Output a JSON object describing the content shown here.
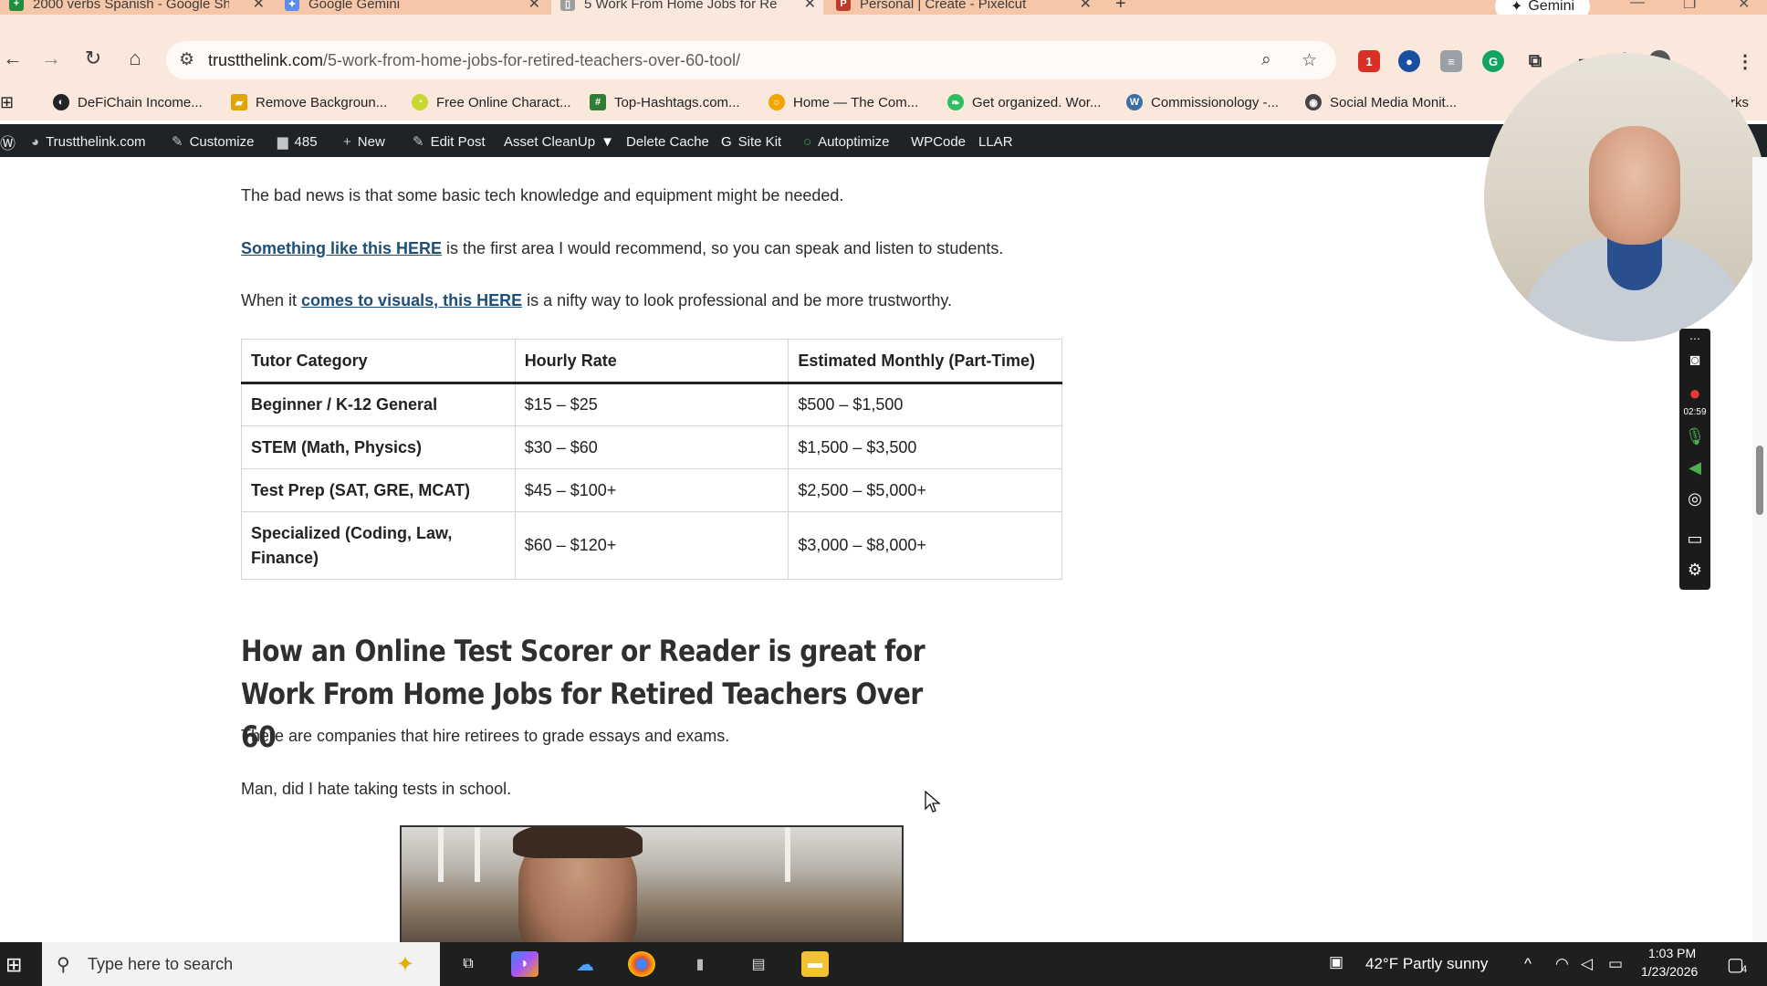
{
  "tabs": [
    {
      "title": "2000 verbs Spanish - Google Sh",
      "favicon": "sheets-icon",
      "color": "#1e8e3e",
      "glyph": "+"
    },
    {
      "title": "Google Gemini",
      "favicon": "gemini-icon",
      "color": "#5b8def",
      "glyph": "✦"
    },
    {
      "title": "5 Work From Home Jobs for Re",
      "favicon": "document-icon",
      "color": "#9e9e9e",
      "glyph": "▯",
      "active": true
    },
    {
      "title": "Personal | Create - Pixelcut",
      "favicon": "pixelcut-icon",
      "color": "#c0392b",
      "glyph": "P"
    }
  ],
  "new_tab": "+",
  "gemini_button": "Gemini",
  "address": {
    "host": "trustthelink.com",
    "path": "/5-work-from-home-jobs-for-retired-teachers-over-60-tool/"
  },
  "bookmarks": [
    {
      "label": "DeFiChain Income...",
      "icon": "defichain-icon",
      "color": "#222"
    },
    {
      "label": "Remove Backgroun...",
      "icon": "remove-bg-icon",
      "color": "#e1a400"
    },
    {
      "label": "Free Online Charact...",
      "icon": "character-icon",
      "color": "#c8d830"
    },
    {
      "label": "Top-Hashtags.com...",
      "icon": "hashtag-icon",
      "color": "#2e7d32"
    },
    {
      "label": "Home — The Com...",
      "icon": "sun-icon",
      "color": "#f0a500"
    },
    {
      "label": "Get organized. Wor...",
      "icon": "evernote-icon",
      "color": "#2dbe60"
    },
    {
      "label": "Commissionology -...",
      "icon": "wordpress-icon",
      "color": "#3b6ea5"
    },
    {
      "label": "Social Media Monit...",
      "icon": "eye-icon",
      "color": "#444"
    }
  ],
  "bookmarks_overflow": "rks",
  "wpbar": {
    "site": "Trustthelink.com",
    "customize": "Customize",
    "comments": "485",
    "new": "New",
    "edit_post": "Edit Post",
    "asset_cleanup": "Asset CleanUp",
    "delete_cache": "Delete Cache",
    "site_kit": "Site Kit",
    "autoptimize": "Autoptimize",
    "wpcode": "WPCode",
    "llar": "LLAR"
  },
  "content": {
    "p1": "The bad news is that some basic tech knowledge and equipment might be needed.",
    "p2_link": "Something like this HERE",
    "p2_rest": " is the first area I would recommend, so you can speak and listen to students.",
    "p3_start": "When it ",
    "p3_link": "comes to visuals, this HERE",
    "p3_rest": " is a nifty way to look professional and be more trustworthy.",
    "table": {
      "headers": [
        "Tutor Category",
        "Hourly Rate",
        "Estimated Monthly (Part-Time)"
      ],
      "rows": [
        [
          "Beginner / K-12 General",
          "$15 – $25",
          "$500 – $1,500"
        ],
        [
          "STEM (Math, Physics)",
          "$30 – $60",
          "$1,500 – $3,500"
        ],
        [
          "Test Prep (SAT, GRE, MCAT)",
          "$45 – $100+",
          "$2,500 – $5,000+"
        ],
        [
          "Specialized (Coding, Law, Finance)",
          "$60 – $120+",
          "$3,000 – $8,000+"
        ]
      ]
    },
    "heading": "How an Online Test Scorer or Reader is great for Work From Home Jobs for Retired Teachers Over 60",
    "p4": "There are companies that hire retirees to grade essays and exams.",
    "p5": "Man, did I hate taking tests in school."
  },
  "recorder": {
    "timer": "02:59"
  },
  "taskbar": {
    "search_placeholder": "Type here to search",
    "weather": "42°F  Partly sunny",
    "time": "1:03 PM",
    "date": "1/23/2026",
    "notifications": "4"
  }
}
